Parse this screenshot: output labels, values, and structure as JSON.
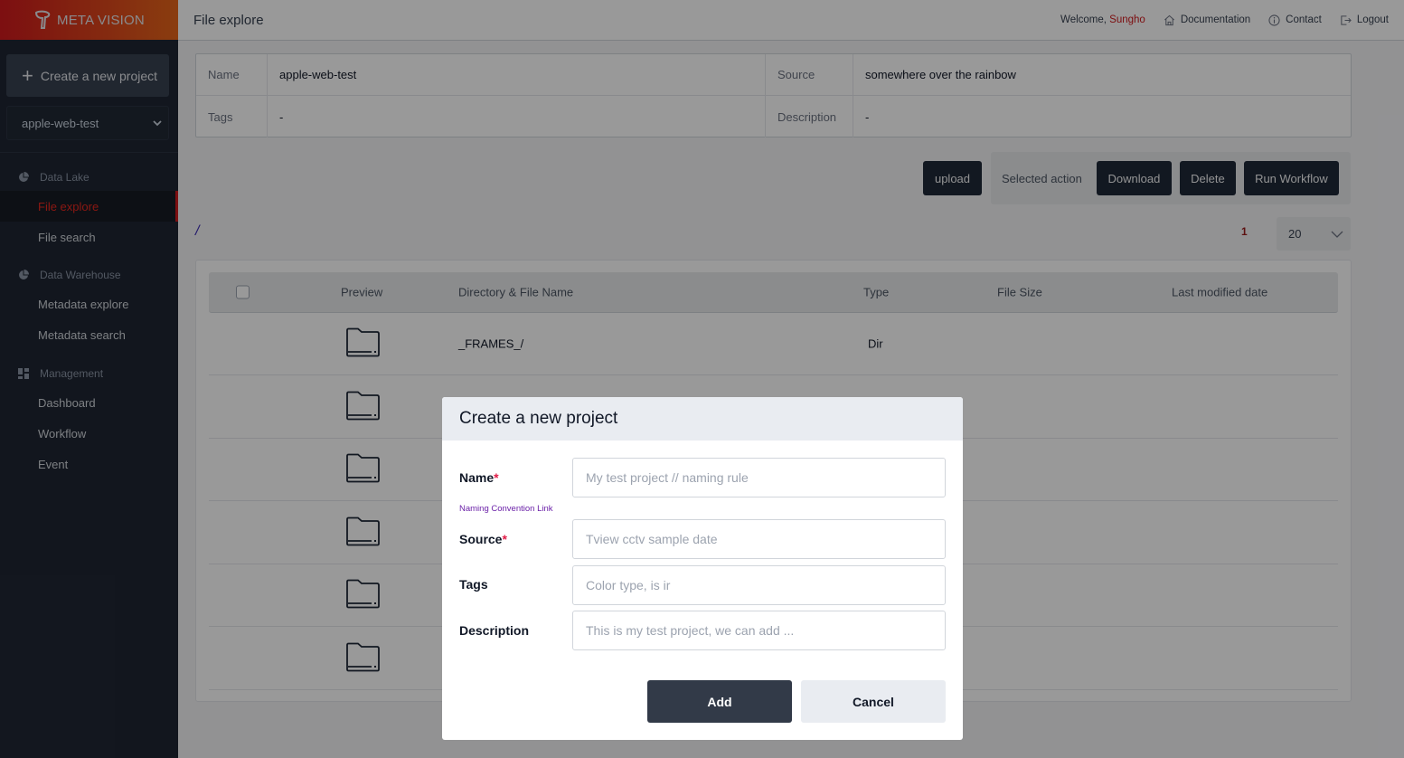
{
  "brand": {
    "name": "META VISION",
    "icon": "meta-vision-logo"
  },
  "sidebar": {
    "create_button": {
      "label": "Create a new project",
      "icon": "plus-icon"
    },
    "project_select": {
      "value": "apple-web-test",
      "icon": "chevron-down-icon"
    },
    "groups": [
      {
        "title": "Data Lake",
        "icon": "pie-chart-icon",
        "items": [
          {
            "label": "File explore",
            "active": true
          },
          {
            "label": "File search",
            "active": false
          }
        ]
      },
      {
        "title": "Data Warehouse",
        "icon": "pie-chart-icon",
        "items": [
          {
            "label": "Metadata explore",
            "active": false
          },
          {
            "label": "Metadata search",
            "active": false
          }
        ]
      },
      {
        "title": "Management",
        "icon": "dashboard-icon",
        "items": [
          {
            "label": "Dashboard",
            "active": false
          },
          {
            "label": "Workflow",
            "active": false
          },
          {
            "label": "Event",
            "active": false
          }
        ]
      }
    ]
  },
  "header": {
    "title": "File explore",
    "welcome_prefix": "Welcome, ",
    "username": "Sungho",
    "links": [
      {
        "label": "Documentation",
        "icon": "home-icon"
      },
      {
        "label": "Contact",
        "icon": "info-icon"
      },
      {
        "label": "Logout",
        "icon": "logout-icon"
      }
    ]
  },
  "project_info": {
    "name_label": "Name",
    "name_value": "apple-web-test",
    "source_label": "Source",
    "source_value": "somewhere over the rainbow",
    "tags_label": "Tags",
    "tags_value": "-",
    "description_label": "Description",
    "description_value": "-"
  },
  "actions": {
    "upload": "upload",
    "selected_action_label": "Selected action",
    "download": "Download",
    "delete": "Delete",
    "run_workflow": "Run Workflow"
  },
  "path": "/",
  "pagination": {
    "current_page": "1",
    "per_page": "20"
  },
  "file_table": {
    "columns": [
      "Preview",
      "Directory & File Name",
      "Type",
      "File Size",
      "Last modified date"
    ],
    "rows": [
      {
        "name": "_FRAMES_/",
        "type": "Dir",
        "size": "",
        "modified": ""
      },
      {
        "name": "",
        "type": "",
        "size": "",
        "modified": ""
      },
      {
        "name": "",
        "type": "",
        "size": "",
        "modified": ""
      },
      {
        "name": "",
        "type": "",
        "size": "",
        "modified": ""
      },
      {
        "name": "",
        "type": "",
        "size": "",
        "modified": ""
      },
      {
        "name": "",
        "type": "",
        "size": "",
        "modified": ""
      }
    ]
  },
  "modal": {
    "title": "Create a new project",
    "fields": {
      "name": {
        "label": "Name",
        "required": "*",
        "placeholder": "My test project // naming rule",
        "value": ""
      },
      "source": {
        "label": "Source",
        "required": "*",
        "placeholder": "Tview cctv sample date",
        "value": ""
      },
      "tags": {
        "label": "Tags",
        "placeholder": "Color type, is ir",
        "value": ""
      },
      "description": {
        "label": "Description",
        "placeholder": "This is my test project, we can add ...",
        "value": ""
      }
    },
    "naming_link": "Naming Convention Link",
    "add_button": "Add",
    "cancel_button": "Cancel"
  },
  "colors": {
    "brand_red": "#d0191d",
    "brand_orange": "#e6661a",
    "sidebar_bg": "#1f2633",
    "button_dark": "#1f2937",
    "required": "#e11d48",
    "link_purple": "#6b21a8"
  }
}
